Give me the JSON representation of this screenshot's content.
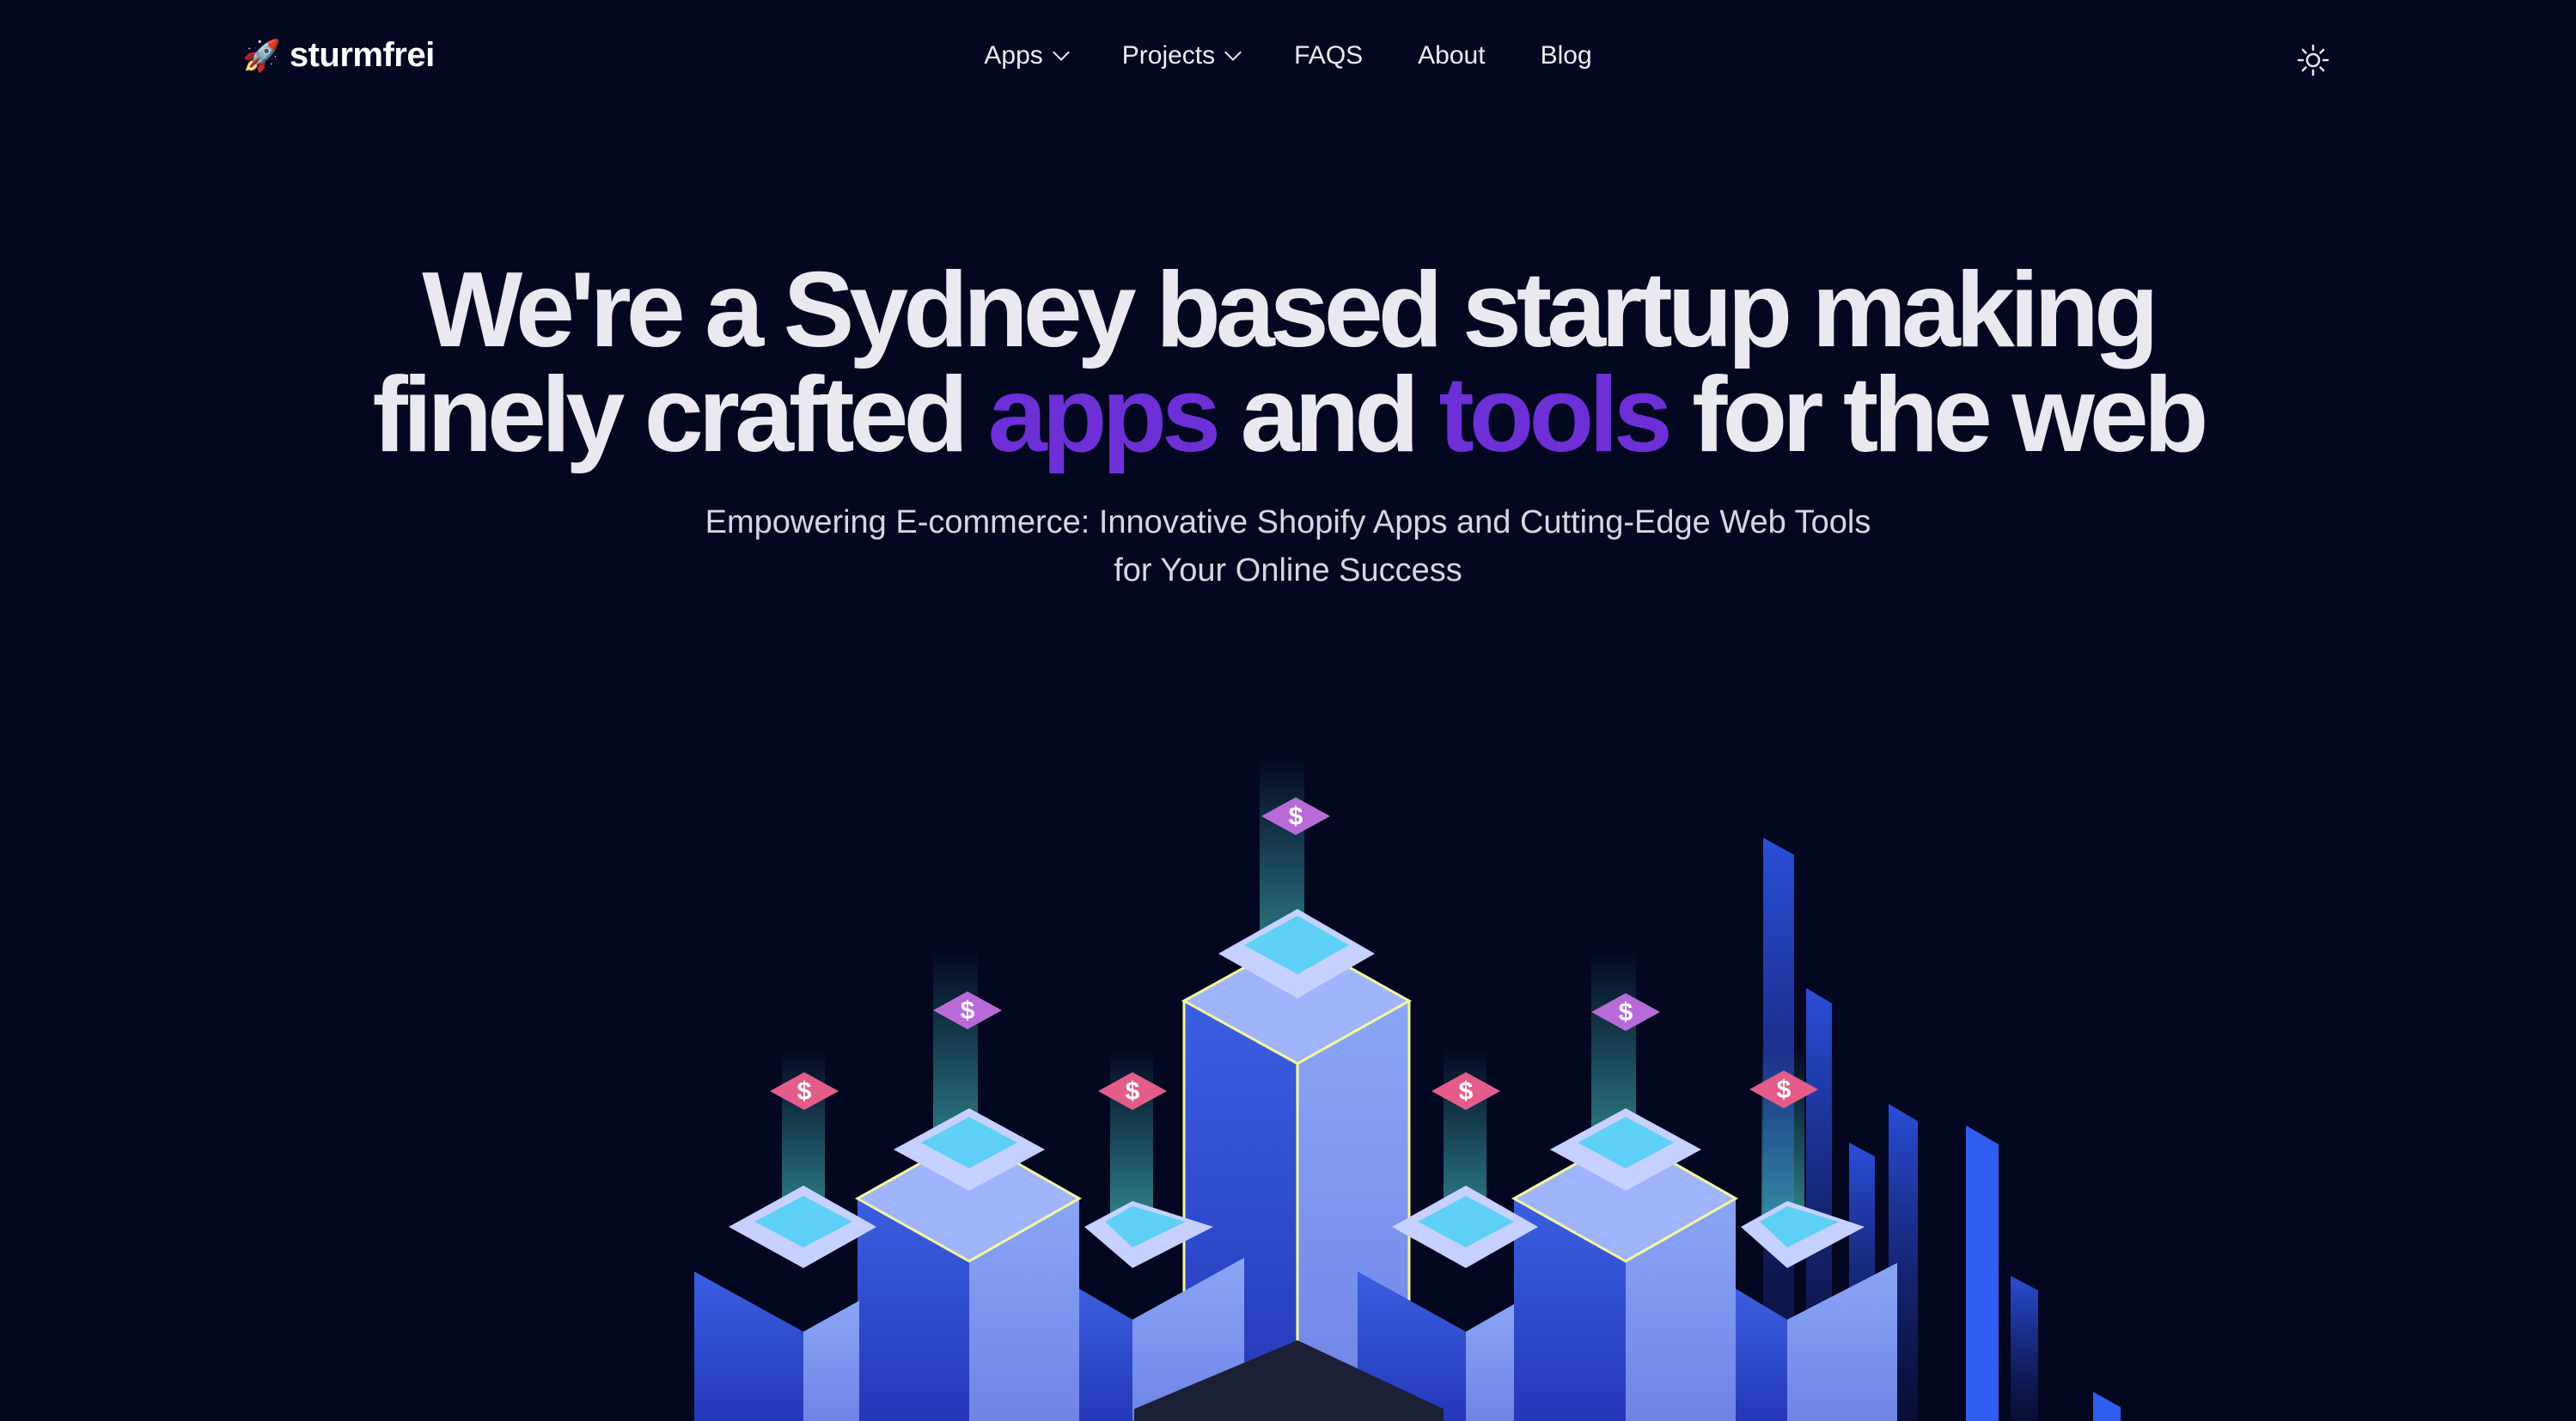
{
  "brand": {
    "logo_icon": "rocket-icon",
    "name": "sturmfrei"
  },
  "nav": {
    "items": [
      {
        "label": "Apps",
        "dropdown": true
      },
      {
        "label": "Projects",
        "dropdown": true
      },
      {
        "label": "FAQS",
        "dropdown": false
      },
      {
        "label": "About",
        "dropdown": false
      },
      {
        "label": "Blog",
        "dropdown": false
      }
    ],
    "theme_toggle_icon": "sun-icon"
  },
  "hero": {
    "title_line1": "We're a Sydney based startup making",
    "title_line2_a": "finely crafted ",
    "title_line2_apps": "apps",
    "title_line2_b": " and ",
    "title_line2_tools": "tools",
    "title_line2_c": " for the web",
    "subtitle_line1": "Empowering E-commerce: Innovative Shopify Apps and Cutting-Edge Web Tools",
    "subtitle_line2": "for Your Online Success"
  },
  "colors": {
    "background": "#040720",
    "accent": "#6d2fd6",
    "text": "#e9e9ef"
  }
}
